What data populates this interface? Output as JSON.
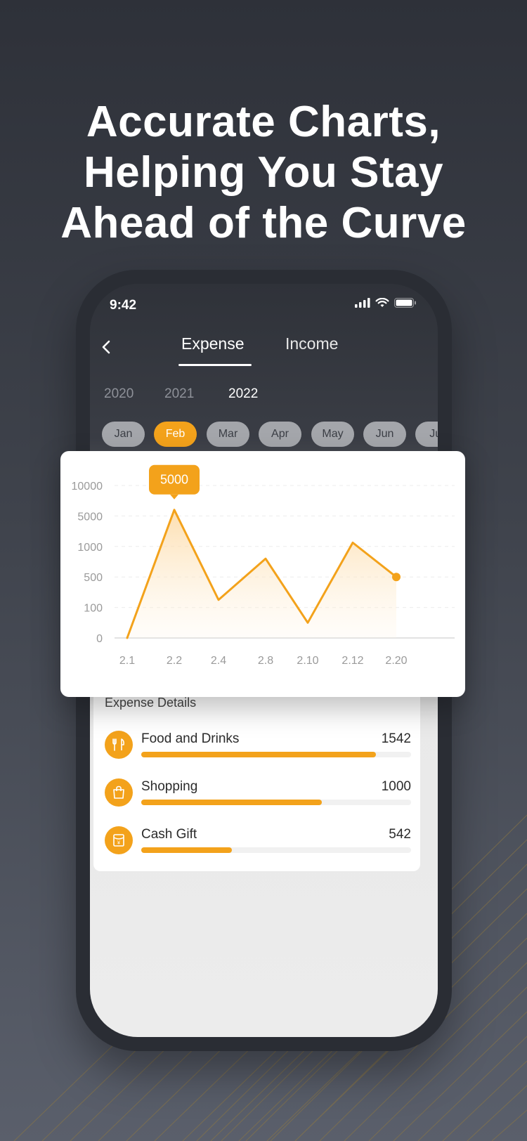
{
  "headline": {
    "line1": "Accurate Charts,",
    "line2": "Helping You Stay",
    "line3": "Ahead of the Curve"
  },
  "status": {
    "time": "9:42"
  },
  "tabs": [
    {
      "label": "Expense",
      "active": true
    },
    {
      "label": "Income",
      "active": false
    }
  ],
  "years": [
    {
      "label": "2020",
      "active": false
    },
    {
      "label": "2021",
      "active": false
    },
    {
      "label": "2022",
      "active": true
    }
  ],
  "months": [
    {
      "label": "Jan",
      "active": false
    },
    {
      "label": "Feb",
      "active": true
    },
    {
      "label": "Mar",
      "active": false
    },
    {
      "label": "Apr",
      "active": false
    },
    {
      "label": "May",
      "active": false
    },
    {
      "label": "Jun",
      "active": false
    },
    {
      "label": "Jul",
      "active": false
    }
  ],
  "chart_data": {
    "type": "line",
    "x": [
      "2.1",
      "2.2",
      "2.4",
      "2.8",
      "2.10",
      "2.12",
      "2.20"
    ],
    "y_ticks": [
      "0",
      "100",
      "500",
      "1000",
      "5000",
      "10000"
    ],
    "series": [
      {
        "values": [
          0,
          6000,
          200,
          800,
          50,
          1500,
          500
        ]
      }
    ],
    "tooltip": {
      "label": "5000",
      "x": "2.2"
    },
    "colors": {
      "line": "#f3a21b",
      "fill": "#fde7c4"
    },
    "grid": true
  },
  "details": {
    "title": "Expense Details",
    "items": [
      {
        "label": "Food and Drinks",
        "value": "1542",
        "progress": 0.87,
        "icon": "fork-knife-icon"
      },
      {
        "label": "Shopping",
        "value": "1000",
        "progress": 0.67,
        "icon": "shopping-bag-icon"
      },
      {
        "label": "Cash Gift",
        "value": "542",
        "progress": 0.335,
        "icon": "red-envelope-icon"
      }
    ]
  },
  "colors": {
    "accent": "#f3a21b"
  }
}
